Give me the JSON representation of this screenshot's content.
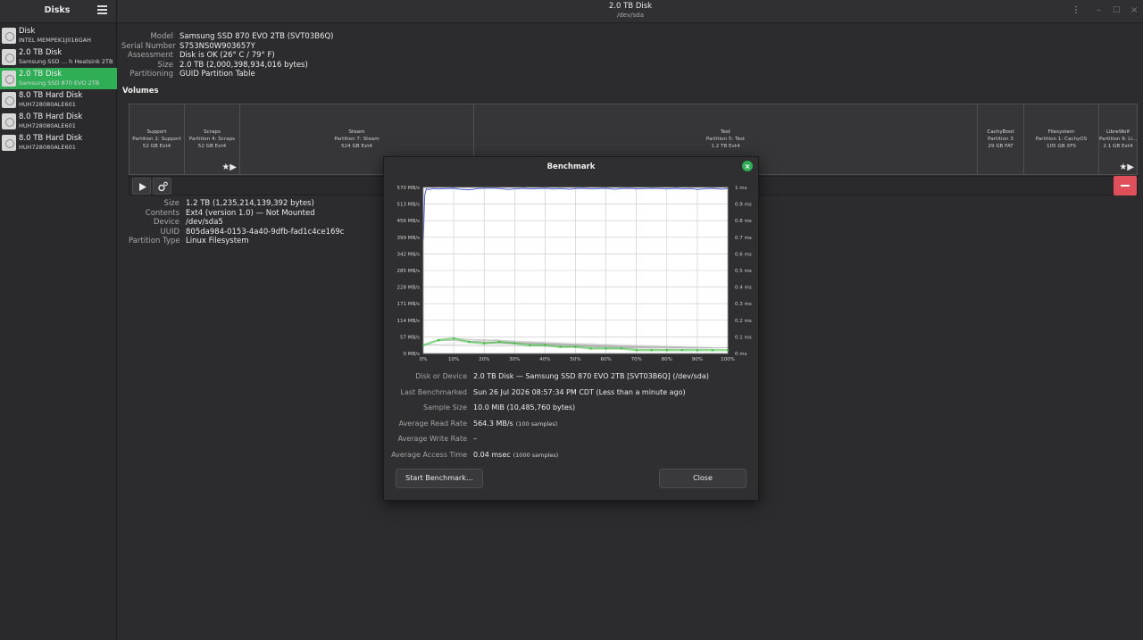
{
  "sidebar": {
    "title": "Disks",
    "disks": [
      {
        "name": "Disk",
        "sub": "INTEL MEMPEK1J016GAH",
        "selected": false
      },
      {
        "name": "2.0 TB Disk",
        "sub": "Samsung SSD … h Heatsink 2TB",
        "selected": false
      },
      {
        "name": "2.0 TB Disk",
        "sub": "Samsung SSD 870 EVO 2TB",
        "selected": true
      },
      {
        "name": "8.0 TB Hard Disk",
        "sub": "HUH728080ALE601",
        "selected": false
      },
      {
        "name": "8.0 TB Hard Disk",
        "sub": "HUH728080ALE601",
        "selected": false
      },
      {
        "name": "8.0 TB Hard Disk",
        "sub": "HUH728080ALE601",
        "selected": false
      }
    ]
  },
  "header": {
    "title": "2.0 TB Disk",
    "subtitle": "/dev/sda",
    "menu_icon": "⋮",
    "minimize_icon": "–",
    "maximize_icon": "□",
    "close_icon": "×"
  },
  "drive": [
    {
      "k": "Model",
      "v": "Samsung SSD 870 EVO 2TB (SVT03B6Q)"
    },
    {
      "k": "Serial Number",
      "v": "S753NS0W903657Y"
    },
    {
      "k": "Assessment",
      "v": "Disk is OK (26° C / 79° F)"
    },
    {
      "k": "Size",
      "v": "2.0 TB (2,000,398,934,016 bytes)"
    },
    {
      "k": "Partitioning",
      "v": "GUID Partition Table"
    }
  ],
  "volumes_title": "Volumes",
  "partitions": [
    {
      "name": "Support",
      "part": "Partition 2: Support",
      "size": "52 GB Ext4"
    },
    {
      "name": "Scraps",
      "part": "Partition 4: Scraps",
      "size": "52 GB Ext4"
    },
    {
      "name": "Steam",
      "part": "Partition 7: Steam",
      "size": "524 GB Ext4"
    },
    {
      "name": "Test",
      "part": "Partition 5: Test",
      "size": "1.2 TB Ext4"
    },
    {
      "name": "CachyBoot",
      "part": "Partition 3",
      "size": "29 GB FAT"
    },
    {
      "name": "Filesystem",
      "part": "Partition 1: CachyOS",
      "size": "105 GB XFS"
    },
    {
      "name": "LibreWolf",
      "part": "Partition 9: Li…",
      "size": "2.1 GB Ext4"
    }
  ],
  "star_play": "★▶",
  "volume": [
    {
      "k": "Size",
      "v": "1.2 TB (1,235,214,139,392 bytes)"
    },
    {
      "k": "Contents",
      "v": "Ext4 (version 1.0) — Not Mounted"
    },
    {
      "k": "Device",
      "v": "/dev/sda5"
    },
    {
      "k": "UUID",
      "v": "805da984-0153-4a40-9dfb-fad1c4ce169c"
    },
    {
      "k": "Partition Type",
      "v": "Linux Filesystem"
    }
  ],
  "dialog": {
    "title": "Benchmark",
    "rows": [
      {
        "k": "Disk or Device",
        "v": "2.0 TB Disk — Samsung SSD 870 EVO 2TB [SVT03B6Q] (/dev/sda)",
        "small": ""
      },
      {
        "k": "Last Benchmarked",
        "v": "Sun 26 Jul 2026 08:57:34 PM CDT (Less than a minute ago)",
        "small": ""
      },
      {
        "k": "Sample Size",
        "v": "10.0 MiB (10,485,760 bytes)",
        "small": ""
      },
      {
        "k": "Average Read Rate",
        "v": "564.3 MB/s",
        "small": "(100 samples)"
      },
      {
        "k": "Average Write Rate",
        "v": "–",
        "small": ""
      },
      {
        "k": "Average Access Time",
        "v": "0.04 msec",
        "small": "(1000 samples)"
      }
    ],
    "start_button": "Start Benchmark…",
    "close_button": "Close"
  },
  "chart_data": {
    "type": "line",
    "x_unit": "%",
    "x_ticks": [
      "0%",
      "10%",
      "20%",
      "30%",
      "40%",
      "50%",
      "60%",
      "70%",
      "80%",
      "90%",
      "100%"
    ],
    "y_left_ticks": [
      "0 MB/s",
      "57 MB/s",
      "114 MB/s",
      "171 MB/s",
      "228 MB/s",
      "285 MB/s",
      "342 MB/s",
      "399 MB/s",
      "456 MB/s",
      "513 MB/s",
      "570 MB/s"
    ],
    "y_right_ticks": [
      "0 ms",
      "0.1 ms",
      "0.2 ms",
      "0.3 ms",
      "0.4 ms",
      "0.5 ms",
      "0.6 ms",
      "0.7 ms",
      "0.8 ms",
      "0.9 ms",
      "1 ms"
    ],
    "ylim_left": [
      0,
      570
    ],
    "ylim_right": [
      0,
      1
    ],
    "grid": true,
    "read_rate": {
      "color": "#4a5bd6",
      "x": [
        0,
        0.5,
        1,
        2,
        3,
        5,
        8,
        10,
        12,
        15,
        18,
        20,
        23,
        25,
        28,
        30,
        33,
        35,
        38,
        40,
        43,
        45,
        48,
        50,
        53,
        55,
        58,
        60,
        63,
        65,
        68,
        70,
        73,
        75,
        78,
        80,
        83,
        85,
        88,
        90,
        93,
        95,
        98,
        100
      ],
      "y": [
        390,
        545,
        565,
        563,
        566,
        565,
        566,
        567,
        564,
        562,
        566,
        567,
        568,
        566,
        563,
        565,
        567,
        565,
        566,
        567,
        565,
        566,
        564,
        566,
        567,
        565,
        566,
        567,
        564,
        566,
        567,
        565,
        566,
        567,
        566,
        565,
        567,
        565,
        566,
        563,
        566,
        567,
        564,
        566
      ]
    },
    "access_time": {
      "color": "#3fbf3f",
      "x": [
        0,
        5,
        10,
        15,
        20,
        25,
        30,
        35,
        40,
        45,
        50,
        55,
        60,
        65,
        70,
        75,
        80,
        85,
        90,
        95,
        100
      ],
      "y": [
        0.05,
        0.08,
        0.09,
        0.07,
        0.06,
        0.07,
        0.06,
        0.05,
        0.05,
        0.04,
        0.04,
        0.03,
        0.03,
        0.03,
        0.02,
        0.02,
        0.02,
        0.02,
        0.02,
        0.02,
        0.02
      ]
    }
  }
}
